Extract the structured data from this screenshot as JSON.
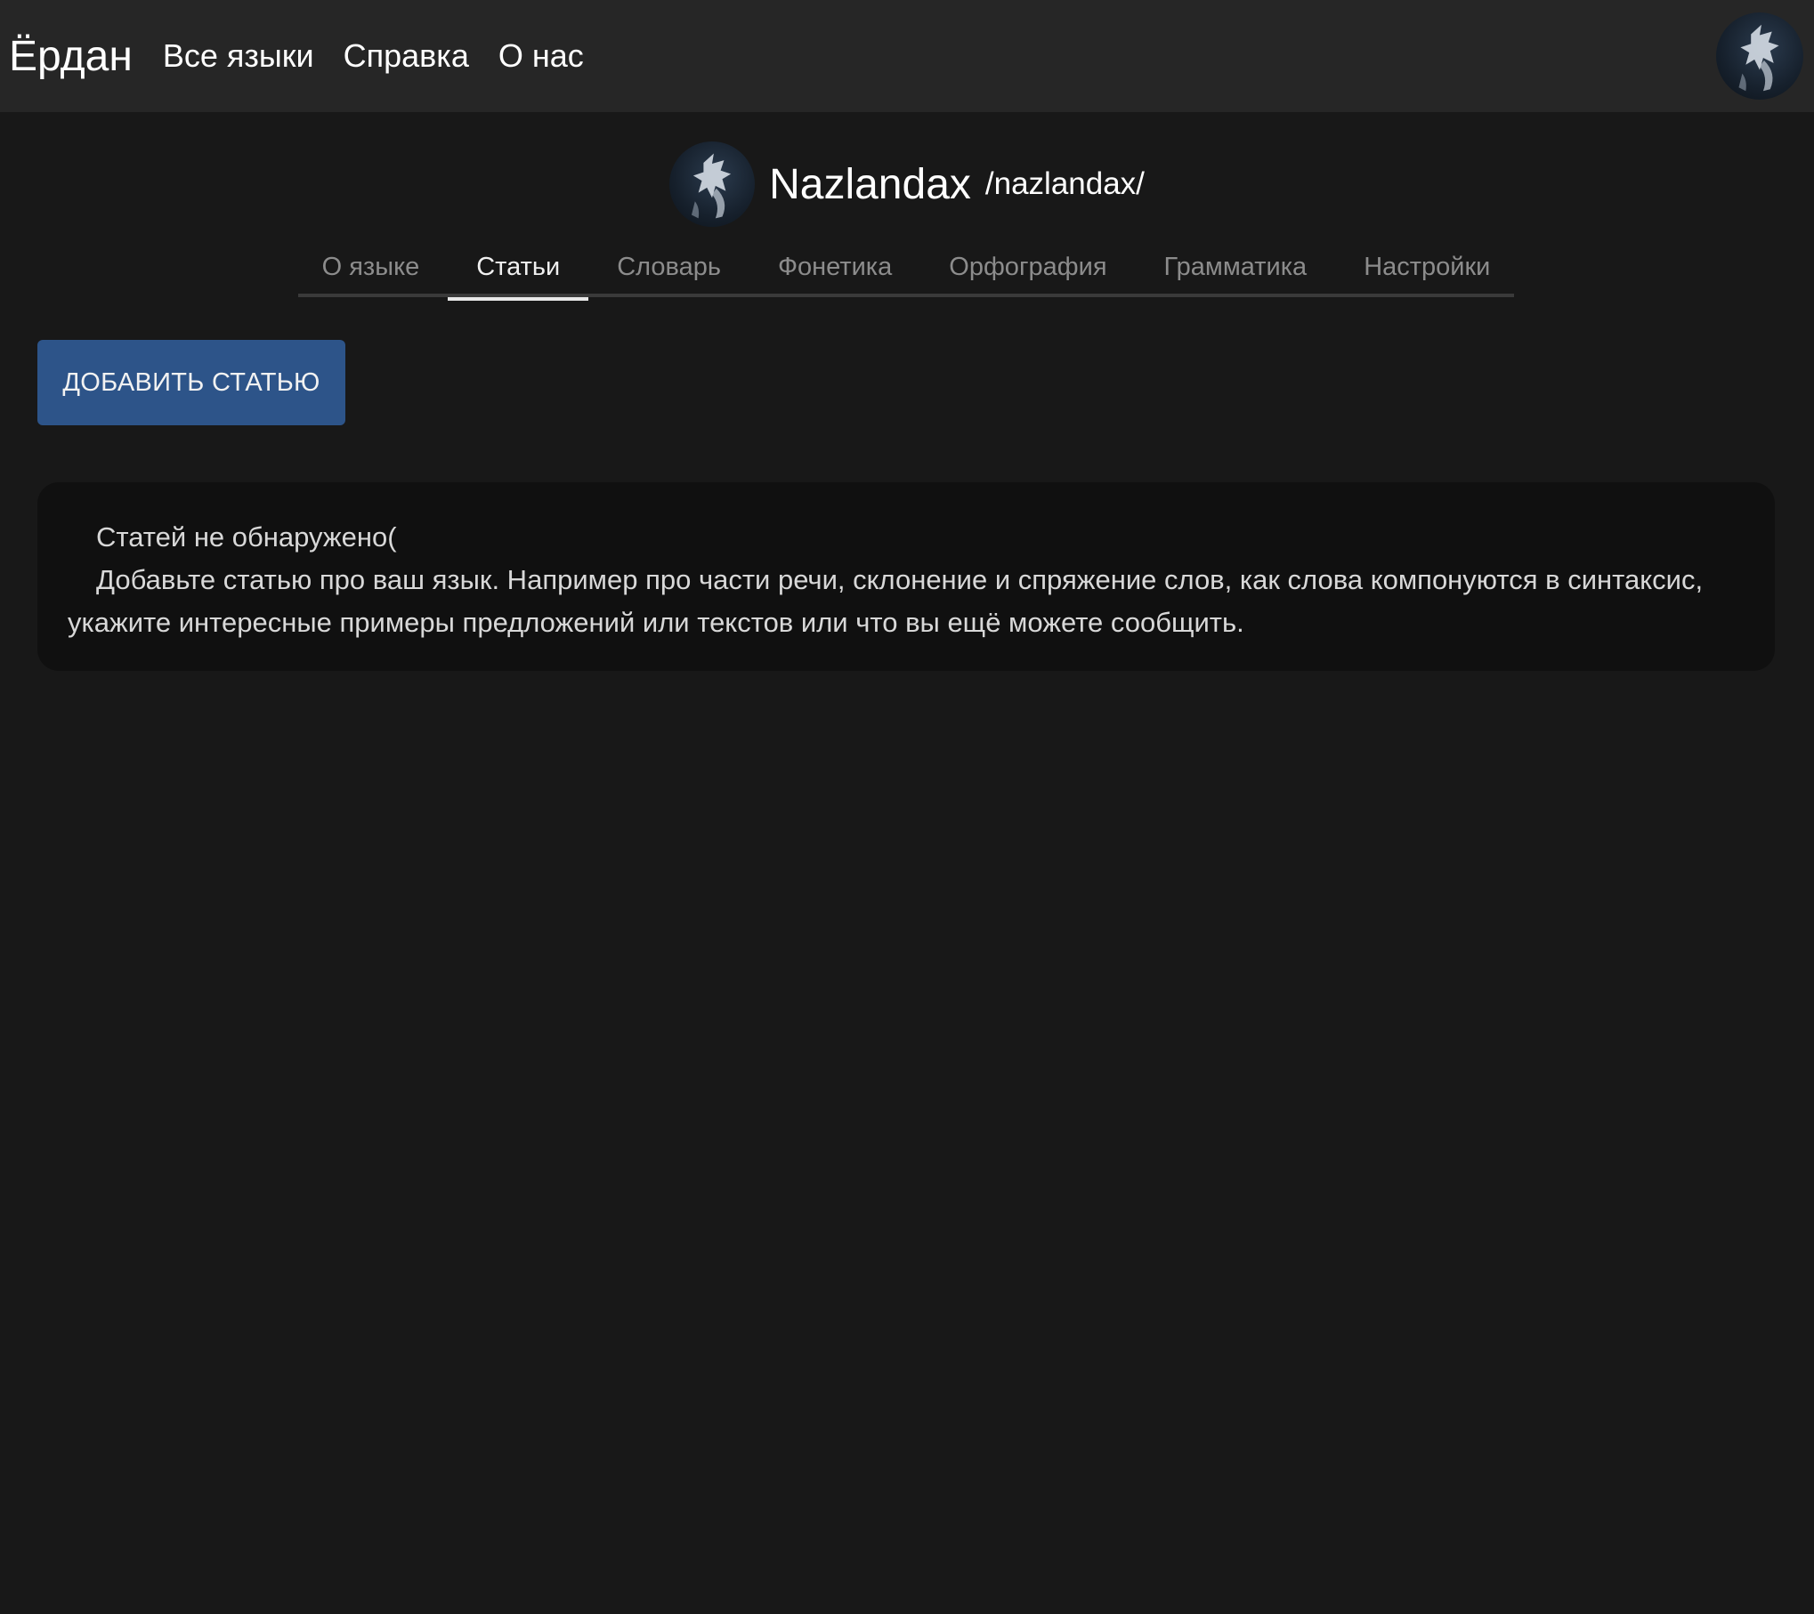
{
  "header": {
    "brand": "Ёрдан",
    "nav": [
      "Все языки",
      "Справка",
      "О нас"
    ],
    "user_avatar_icon": "user-avatar-icon"
  },
  "language": {
    "name": "Nazlandax",
    "slug": "/nazlandax/",
    "avatar_icon": "language-avatar-icon"
  },
  "tabs": [
    {
      "label": "О языке",
      "active": false
    },
    {
      "label": "Статьи",
      "active": true
    },
    {
      "label": "Словарь",
      "active": false
    },
    {
      "label": "Фонетика",
      "active": false
    },
    {
      "label": "Орфография",
      "active": false
    },
    {
      "label": "Грамматика",
      "active": false
    },
    {
      "label": "Настройки",
      "active": false
    }
  ],
  "actions": {
    "add_article": "ДОБАВИТЬ СТАТЬЮ"
  },
  "empty_state": {
    "title": "Статей не обнаружено(",
    "description": "Добавьте статью про ваш язык. Например про части речи, склонение и спряжение слов, как слова компонуются в синтаксис, укажите интересные примеры предложений или текстов или что вы ещё можете сообщить."
  },
  "colors": {
    "background": "#181818",
    "topbar": "#262626",
    "button": "#2d5489",
    "card": "#101010"
  }
}
